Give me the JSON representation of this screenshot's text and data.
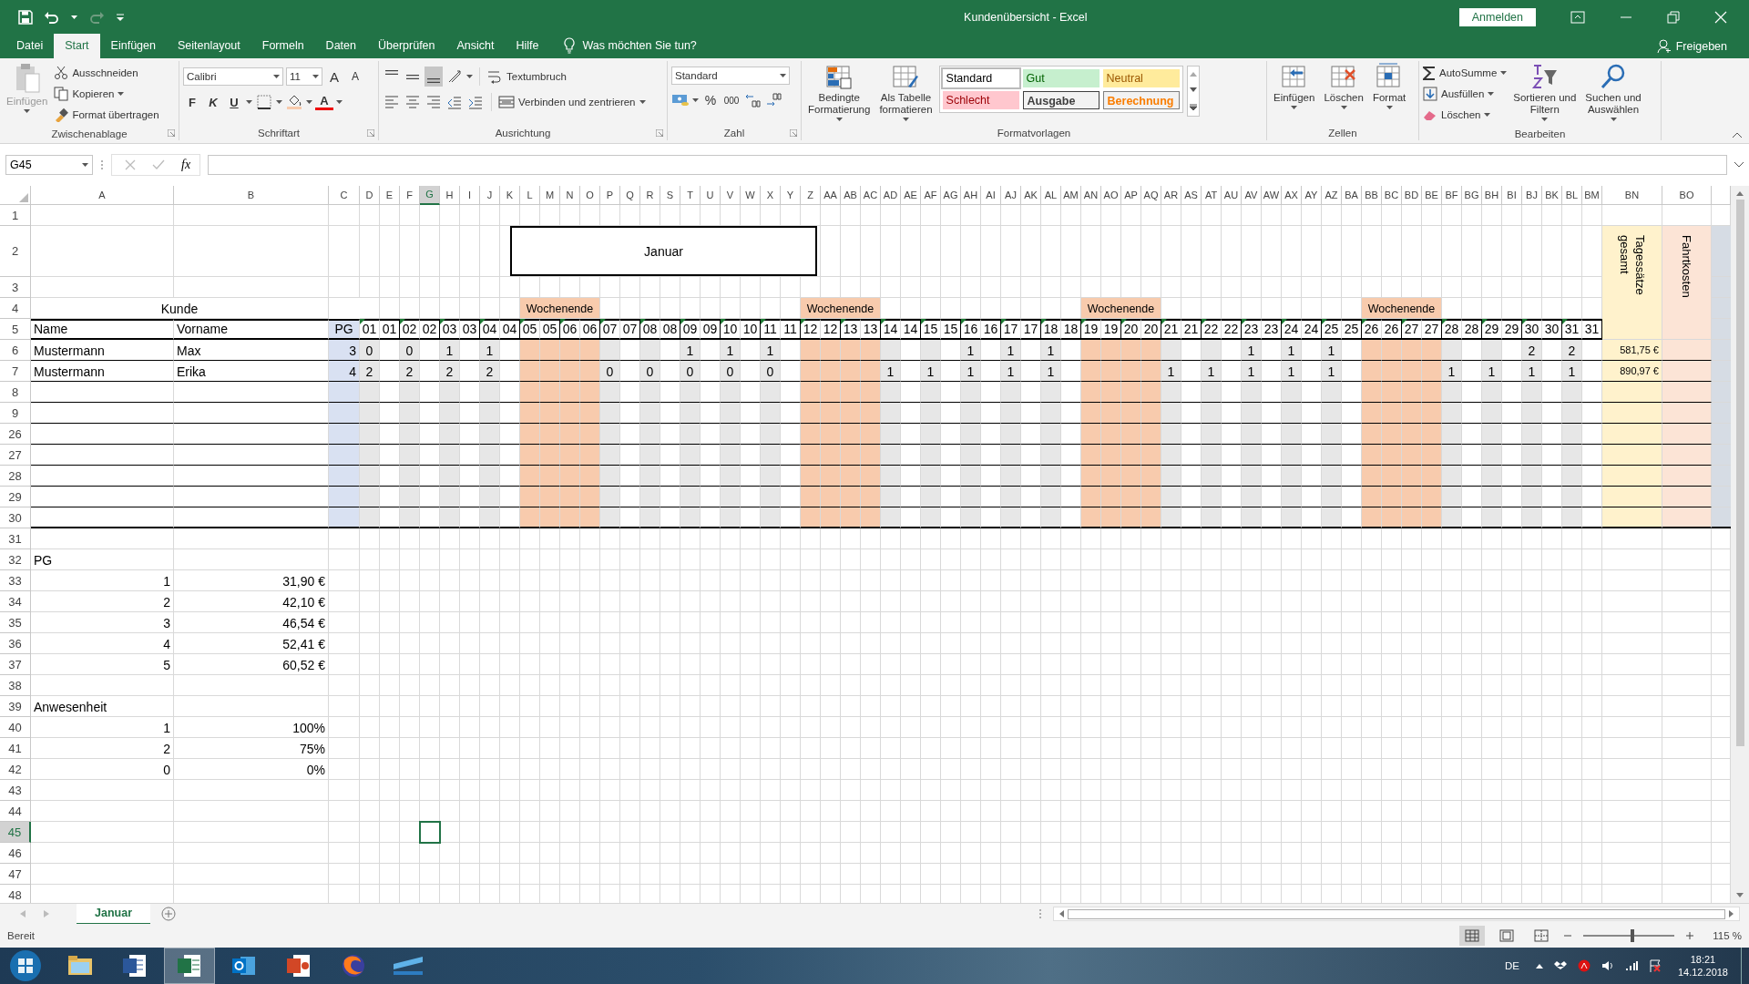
{
  "title_bar": {
    "title": "Kundenübersicht  -  Excel",
    "sign_in": "Anmelden"
  },
  "tabs": [
    {
      "label": "Datei",
      "selected": false
    },
    {
      "label": "Start",
      "selected": true
    },
    {
      "label": "Einfügen",
      "selected": false
    },
    {
      "label": "Seitenlayout",
      "selected": false
    },
    {
      "label": "Formeln",
      "selected": false
    },
    {
      "label": "Daten",
      "selected": false
    },
    {
      "label": "Überprüfen",
      "selected": false
    },
    {
      "label": "Ansicht",
      "selected": false
    },
    {
      "label": "Hilfe",
      "selected": false
    }
  ],
  "tell_me": "Was möchten Sie tun?",
  "share": "Freigeben",
  "ribbon": [
    {
      "kind": "clipboard",
      "name": "Zwischenablage",
      "launcher": true,
      "paste": {
        "label": "Einfügen",
        "disabled": true
      },
      "actions": [
        "Ausschneiden",
        "Kopieren",
        "Format übertragen"
      ]
    },
    {
      "kind": "font",
      "name": "Schriftart",
      "launcher": true,
      "font": "Calibri",
      "size": "11",
      "grow": "A",
      "shrink": "A",
      "styles": [
        "F",
        "K",
        "U"
      ],
      "color_button": "A"
    },
    {
      "kind": "alignment",
      "name": "Ausrichtung",
      "launcher": true,
      "vertical_align": [
        {
          "selected": false
        },
        {
          "selected": false
        },
        {
          "selected": true
        }
      ],
      "wrap": "Textumbruch",
      "merge": "Verbinden und zentrieren"
    },
    {
      "kind": "number",
      "name": "Zahl",
      "launcher": true,
      "format": "Standard",
      "percent": "%",
      "thousands": "000"
    },
    {
      "kind": "styles",
      "name": "Formatvorlagen",
      "launcher": false,
      "buttons": [
        "Bedingte\nFormatierung",
        "Als Tabelle\nformatieren"
      ],
      "cell_styles": [
        {
          "label": "Standard",
          "kind": "normal",
          "selected": true
        },
        {
          "label": "Gut",
          "kind": "good",
          "selected": false
        },
        {
          "label": "Neutral",
          "kind": "neutral",
          "selected": false
        },
        {
          "label": "Schlecht",
          "kind": "bad",
          "selected": false
        },
        {
          "label": "Ausgabe",
          "kind": "output",
          "selected": false
        },
        {
          "label": "Berechnung",
          "kind": "calculation",
          "selected": false
        }
      ]
    },
    {
      "kind": "cells",
      "name": "Zellen",
      "launcher": false,
      "buttons": [
        "Einfügen",
        "Löschen",
        "Format"
      ]
    },
    {
      "kind": "editing",
      "name": "Bearbeiten",
      "launcher": false,
      "actions": [
        "AutoSumme",
        "Ausfüllen",
        "Löschen"
      ],
      "buttons": [
        "Sortieren und\nFiltern",
        "Suchen und\nAuswählen"
      ]
    }
  ],
  "formula_bar": {
    "name_box": "G45",
    "function_button": "fx"
  },
  "sheet": {
    "columns": [
      {
        "label": "A",
        "selected": false
      },
      {
        "label": "B",
        "selected": false
      },
      {
        "label": "C",
        "selected": false
      },
      {
        "label": "D",
        "selected": false
      },
      {
        "label": "E",
        "selected": false
      },
      {
        "label": "F",
        "selected": false
      },
      {
        "label": "G",
        "selected": true
      },
      {
        "label": "H",
        "selected": false
      },
      {
        "label": "I",
        "selected": false
      },
      {
        "label": "J",
        "selected": false
      },
      {
        "label": "K",
        "selected": false
      },
      {
        "label": "L",
        "selected": false
      },
      {
        "label": "M",
        "selected": false
      },
      {
        "label": "N",
        "selected": false
      },
      {
        "label": "O",
        "selected": false
      },
      {
        "label": "P",
        "selected": false
      },
      {
        "label": "Q",
        "selected": false
      },
      {
        "label": "R",
        "selected": false
      },
      {
        "label": "S",
        "selected": false
      },
      {
        "label": "T",
        "selected": false
      },
      {
        "label": "U",
        "selected": false
      },
      {
        "label": "V",
        "selected": false
      },
      {
        "label": "W",
        "selected": false
      },
      {
        "label": "X",
        "selected": false
      },
      {
        "label": "Y",
        "selected": false
      },
      {
        "label": "Z",
        "selected": false
      },
      {
        "label": "AA",
        "selected": false
      },
      {
        "label": "AB",
        "selected": false
      },
      {
        "label": "AC",
        "selected": false
      },
      {
        "label": "AD",
        "selected": false
      },
      {
        "label": "AE",
        "selected": false
      },
      {
        "label": "AF",
        "selected": false
      },
      {
        "label": "AG",
        "selected": false
      },
      {
        "label": "AH",
        "selected": false
      },
      {
        "label": "AI",
        "selected": false
      },
      {
        "label": "AJ",
        "selected": false
      },
      {
        "label": "AK",
        "selected": false
      },
      {
        "label": "AL",
        "selected": false
      },
      {
        "label": "AM",
        "selected": false
      },
      {
        "label": "AN",
        "selected": false
      },
      {
        "label": "AO",
        "selected": false
      },
      {
        "label": "AP",
        "selected": false
      },
      {
        "label": "AQ",
        "selected": false
      },
      {
        "label": "AR",
        "selected": false
      },
      {
        "label": "AS",
        "selected": false
      },
      {
        "label": "AT",
        "selected": false
      },
      {
        "label": "AU",
        "selected": false
      },
      {
        "label": "AV",
        "selected": false
      },
      {
        "label": "AW",
        "selected": false
      },
      {
        "label": "AX",
        "selected": false
      },
      {
        "label": "AY",
        "selected": false
      },
      {
        "label": "AZ",
        "selected": false
      },
      {
        "label": "BA",
        "selected": false
      },
      {
        "label": "BB",
        "selected": false
      },
      {
        "label": "BC",
        "selected": false
      },
      {
        "label": "BD",
        "selected": false
      },
      {
        "label": "BE",
        "selected": false
      },
      {
        "label": "BF",
        "selected": false
      },
      {
        "label": "BG",
        "selected": false
      },
      {
        "label": "BH",
        "selected": false
      },
      {
        "label": "BI",
        "selected": false
      },
      {
        "label": "BJ",
        "selected": false
      },
      {
        "label": "BK",
        "selected": false
      },
      {
        "label": "BL",
        "selected": false
      },
      {
        "label": "BM",
        "selected": false
      },
      {
        "label": "BN",
        "selected": false
      },
      {
        "label": "BO",
        "selected": false
      }
    ],
    "table": {
      "title": "Januar",
      "group_label": "Kunde",
      "name_head": "Name",
      "first_name_head": "Vorname",
      "pg_head": "PG",
      "total_head": "Tagessätze\ngesamt",
      "costs_head": "Fahrtkosten"
    },
    "days": [
      {
        "label_1": "01",
        "label_2": "01",
        "weekend": false
      },
      {
        "label_1": "02",
        "label_2": "02",
        "weekend": false
      },
      {
        "label_1": "03",
        "label_2": "03",
        "weekend": false
      },
      {
        "label_1": "04",
        "label_2": "04",
        "weekend": false
      },
      {
        "label_1": "05",
        "label_2": "05",
        "weekend": true,
        "banner": "Wochenende"
      },
      {
        "label_1": "06",
        "label_2": "06",
        "weekend": true
      },
      {
        "label_1": "07",
        "label_2": "07",
        "weekend": false
      },
      {
        "label_1": "08",
        "label_2": "08",
        "weekend": false
      },
      {
        "label_1": "09",
        "label_2": "09",
        "weekend": false
      },
      {
        "label_1": "10",
        "label_2": "10",
        "weekend": false
      },
      {
        "label_1": "11",
        "label_2": "11",
        "weekend": false
      },
      {
        "label_1": "12",
        "label_2": "12",
        "weekend": true,
        "banner": "Wochenende"
      },
      {
        "label_1": "13",
        "label_2": "13",
        "weekend": true
      },
      {
        "label_1": "14",
        "label_2": "14",
        "weekend": false
      },
      {
        "label_1": "15",
        "label_2": "15",
        "weekend": false
      },
      {
        "label_1": "16",
        "label_2": "16",
        "weekend": false
      },
      {
        "label_1": "17",
        "label_2": "17",
        "weekend": false
      },
      {
        "label_1": "18",
        "label_2": "18",
        "weekend": false
      },
      {
        "label_1": "19",
        "label_2": "19",
        "weekend": true,
        "banner": "Wochenende"
      },
      {
        "label_1": "20",
        "label_2": "20",
        "weekend": true
      },
      {
        "label_1": "21",
        "label_2": "21",
        "weekend": false
      },
      {
        "label_1": "22",
        "label_2": "22",
        "weekend": false
      },
      {
        "label_1": "23",
        "label_2": "23",
        "weekend": false
      },
      {
        "label_1": "24",
        "label_2": "24",
        "weekend": false
      },
      {
        "label_1": "25",
        "label_2": "25",
        "weekend": false
      },
      {
        "label_1": "26",
        "label_2": "26",
        "weekend": true,
        "banner": "Wochenende"
      },
      {
        "label_1": "27",
        "label_2": "27",
        "weekend": true
      },
      {
        "label_1": "28",
        "label_2": "28",
        "weekend": false
      },
      {
        "label_1": "29",
        "label_2": "29",
        "weekend": false
      },
      {
        "label_1": "30",
        "label_2": "30",
        "weekend": false
      },
      {
        "label_1": "31",
        "label_2": "31",
        "weekend": false
      }
    ],
    "rows": [
      {
        "label": "1",
        "selected": false,
        "kind": "blank"
      },
      {
        "label": "2",
        "selected": false,
        "kind": "title"
      },
      {
        "label": "3",
        "selected": false,
        "kind": "blank"
      },
      {
        "label": "4",
        "selected": false,
        "kind": "group"
      },
      {
        "label": "5",
        "selected": false,
        "kind": "head"
      },
      {
        "label": "6",
        "selected": false,
        "kind": "customer",
        "name": "Mustermann",
        "first_name": "Max",
        "pg": "3",
        "days": {
          "d1": "0",
          "d2": "0",
          "d3": "1",
          "d4": "1",
          "d9": "1",
          "d10": "1",
          "d11": "1",
          "d16": "1",
          "d17": "1",
          "d18": "1",
          "d23": "1",
          "d24": "1",
          "d25": "1",
          "d30": "2",
          "d31": "2"
        },
        "total": "581,75 €"
      },
      {
        "label": "7",
        "selected": false,
        "kind": "customer",
        "name": "Mustermann",
        "first_name": "Erika",
        "pg": "4",
        "days": {
          "d1": "2",
          "d2": "2",
          "d3": "2",
          "d4": "2",
          "d7": "0",
          "d8": "0",
          "d9": "0",
          "d10": "0",
          "d11": "0",
          "d14": "1",
          "d15": "1",
          "d16": "1",
          "d17": "1",
          "d18": "1",
          "d21": "1",
          "d22": "1",
          "d23": "1",
          "d24": "1",
          "d25": "1",
          "d28": "1",
          "d29": "1",
          "d30": "1",
          "d31": "1"
        },
        "total": "890,97 €"
      },
      {
        "label": "8",
        "selected": false,
        "kind": "table"
      },
      {
        "label": "9",
        "selected": false,
        "kind": "table"
      },
      {
        "label": "26",
        "selected": false,
        "kind": "table"
      },
      {
        "label": "27",
        "selected": false,
        "kind": "table"
      },
      {
        "label": "28",
        "selected": false,
        "kind": "table"
      },
      {
        "label": "29",
        "selected": false,
        "kind": "table"
      },
      {
        "label": "30",
        "selected": false,
        "kind": "table_end"
      },
      {
        "label": "31",
        "selected": false,
        "kind": "blank"
      },
      {
        "label": "32",
        "selected": false,
        "kind": "text",
        "a": "PG"
      },
      {
        "label": "33",
        "selected": false,
        "kind": "pair",
        "a": "1",
        "b": "31,90 €"
      },
      {
        "label": "34",
        "selected": false,
        "kind": "pair",
        "a": "2",
        "b": "42,10 €"
      },
      {
        "label": "35",
        "selected": false,
        "kind": "pair",
        "a": "3",
        "b": "46,54 €"
      },
      {
        "label": "36",
        "selected": false,
        "kind": "pair",
        "a": "4",
        "b": "52,41 €"
      },
      {
        "label": "37",
        "selected": false,
        "kind": "pair",
        "a": "5",
        "b": "60,52 €"
      },
      {
        "label": "38",
        "selected": false,
        "kind": "blank"
      },
      {
        "label": "39",
        "selected": false,
        "kind": "text",
        "a": "Anwesenheit"
      },
      {
        "label": "40",
        "selected": false,
        "kind": "pair",
        "a": "1",
        "b": "100%"
      },
      {
        "label": "41",
        "selected": false,
        "kind": "pair",
        "a": "2",
        "b": "75%"
      },
      {
        "label": "42",
        "selected": false,
        "kind": "pair",
        "a": "0",
        "b": "0%"
      },
      {
        "label": "43",
        "selected": false,
        "kind": "blank"
      },
      {
        "label": "44",
        "selected": false,
        "kind": "blank"
      },
      {
        "label": "45",
        "selected": true,
        "kind": "blank"
      },
      {
        "label": "46",
        "selected": false,
        "kind": "blank"
      },
      {
        "label": "47",
        "selected": false,
        "kind": "blank"
      },
      {
        "label": "48",
        "selected": false,
        "kind": "blank"
      }
    ]
  },
  "sheet_tabs": [
    {
      "label": "Januar",
      "selected": true
    }
  ],
  "status_bar": {
    "status": "Bereit",
    "views": [
      {
        "selected": true
      },
      {
        "selected": false
      },
      {
        "selected": false
      }
    ],
    "zoom_slider": {
      "level": 0.54
    },
    "zoom": "115 %"
  },
  "taskbar": {
    "apps": [
      {
        "active": false
      },
      {
        "active": false
      },
      {
        "active": true
      },
      {
        "active": false
      },
      {
        "active": false
      },
      {
        "active": false
      },
      {
        "active": false
      }
    ],
    "language": "DE",
    "time": "18:21",
    "date": "14.12.2018"
  }
}
